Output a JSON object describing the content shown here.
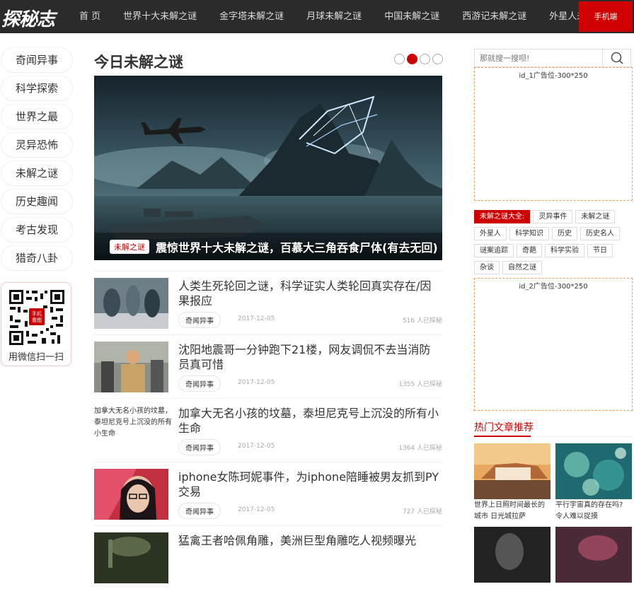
{
  "site": {
    "logo": "探秘志"
  },
  "nav": {
    "items": [
      "首 页",
      "世界十大未解之谜",
      "金字塔未解之谜",
      "月球未解之谜",
      "中国未解之谜",
      "西游记未解之谜",
      "外星人未解之谜"
    ],
    "mobile": "手机端"
  },
  "categories": [
    "奇闻异事",
    "科学探索",
    "世界之最",
    "灵异恐怖",
    "未解之谜",
    "历史趣闻",
    "考古发现",
    "猎奇八卦"
  ],
  "qr": {
    "badge": "手机看图",
    "label": "用微信扫一扫"
  },
  "main": {
    "title": "今日未解之谜",
    "carousel_active_index": 1,
    "hero": {
      "tag": "未解之谜",
      "caption": "震惊世界十大未解之谜，百慕大三角吞食尸体(有去无回)"
    }
  },
  "articles": [
    {
      "title": "人类生死轮回之谜，科学证实人类轮回真实存在/因果报应",
      "tag": "奇闻异事",
      "date": "2017-12-05",
      "reads": "516 人已探秘"
    },
    {
      "title": "沈阳地震哥一分钟跑下21楼，网友调侃不去当消防员真可惜",
      "tag": "奇闻异事",
      "date": "2017-12-05",
      "reads": "1355 人已探秘"
    },
    {
      "thumb_alt": "加拿大无名小孩的坟墓，泰坦尼克号上沉没的所有小生命",
      "title": "加拿大无名小孩的坟墓，泰坦尼克号上沉没的所有小生命",
      "tag": "奇闻异事",
      "date": "2017-12-05",
      "reads": "1364 人已探秘"
    },
    {
      "title": "iphone女陈珂妮事件，为iphone陪睡被男友抓到PY交易",
      "tag": "奇闻异事",
      "date": "2017-12-05",
      "reads": "727 人已探秘"
    },
    {
      "title": "猛禽王者哈佩角雕，美洲巨型角雕吃人视频曝光"
    }
  ],
  "sidebar": {
    "search_placeholder": "那就搜一搜呗!",
    "ad1": "id_1广告位-300*250",
    "ad2": "id_2广告位-300*250",
    "tags_heading": "未解之谜大全:",
    "tags": [
      "灵异事件",
      "未解之谜",
      "外星人",
      "科学知识",
      "历史",
      "历史名人",
      "谜案追踪",
      "奇葩",
      "科学实验",
      "节日",
      "杂谈",
      "自然之谜"
    ],
    "hot_title": "热门文章推荐",
    "hot": [
      {
        "title": "世界上日照时间最长的城市 日光城拉萨"
      },
      {
        "title": "平行宇宙真的存在吗? 令人难以捉摸"
      }
    ]
  }
}
